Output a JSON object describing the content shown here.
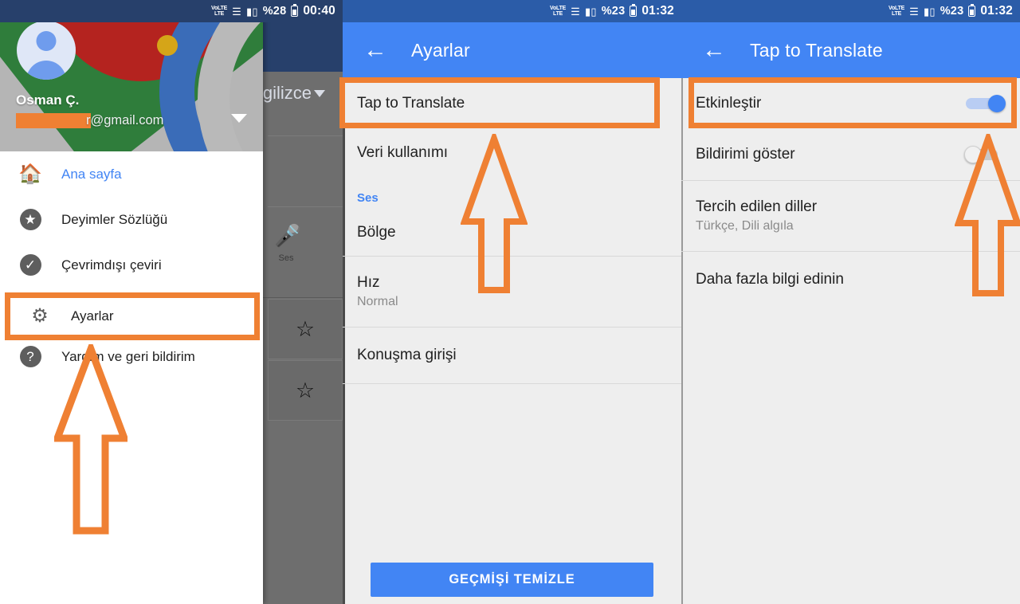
{
  "panels": {
    "left": {
      "status": {
        "network": "LTE",
        "battery_pct": "%28",
        "time": "00:40",
        "wifi_icon": "wifi-icon",
        "signal_icon": "signal-icon",
        "battery_icon": "battery-icon"
      },
      "background_app": {
        "language_label": "gilizce",
        "mic_label": "Ses"
      },
      "account": {
        "name": "Osman Ç.",
        "email_suffix": "r@gmail.com"
      },
      "menu": [
        {
          "label": "Ana sayfa",
          "icon": "home-icon",
          "active": true
        },
        {
          "label": "Deyimler Sözlüğü",
          "icon": "star-circle-icon",
          "active": false
        },
        {
          "label": "Çevrimdışı çeviri",
          "icon": "check-circle-icon",
          "active": false
        },
        {
          "label": "Ayarlar",
          "icon": "gear-icon",
          "active": false,
          "highlighted": true
        },
        {
          "label": "Yardım ve geri bildirim",
          "icon": "help-circle-icon",
          "active": false
        }
      ]
    },
    "middle": {
      "status": {
        "network": "LTE",
        "battery_pct": "%23",
        "time": "01:32"
      },
      "appbar": {
        "title": "Ayarlar",
        "back_icon": "back-arrow-icon"
      },
      "rows": [
        {
          "type": "item",
          "title": "Tap to Translate",
          "highlighted": true
        },
        {
          "type": "item",
          "title": "Veri kullanımı"
        },
        {
          "type": "section",
          "title": "Ses"
        },
        {
          "type": "item",
          "title": "Bölge"
        },
        {
          "type": "item",
          "title": "Hız",
          "sub": "Normal"
        },
        {
          "type": "item",
          "title": "Konuşma girişi"
        }
      ],
      "clear_button": "GEÇMİŞİ TEMİZLE"
    },
    "right": {
      "status": {
        "network": "LTE",
        "battery_pct": "%23",
        "time": "01:32"
      },
      "appbar": {
        "title": "Tap to Translate",
        "back_icon": "back-arrow-icon"
      },
      "rows": [
        {
          "type": "toggle",
          "title": "Etkinleştir",
          "on": true,
          "highlighted": true
        },
        {
          "type": "toggle",
          "title": "Bildirimi göster",
          "on": false
        },
        {
          "type": "item",
          "title": "Tercih edilen diller",
          "sub": "Türkçe, Dili algıla"
        },
        {
          "type": "item",
          "title": "Daha fazla bilgi edinin"
        }
      ]
    }
  },
  "annotations": {
    "accent_color": "#ef8033",
    "arrows": [
      {
        "name": "arrow-pointing-to-ayarlar"
      },
      {
        "name": "arrow-pointing-to-tap-to-translate"
      },
      {
        "name": "arrow-pointing-to-etkinlestir"
      }
    ]
  },
  "colors": {
    "appbar_blue": "#4285f4",
    "statusbar_blue": "#2b5ca8",
    "statusbar_dark": "#27406b",
    "accent_orange": "#ef8033",
    "list_bg": "#eeeeee"
  }
}
